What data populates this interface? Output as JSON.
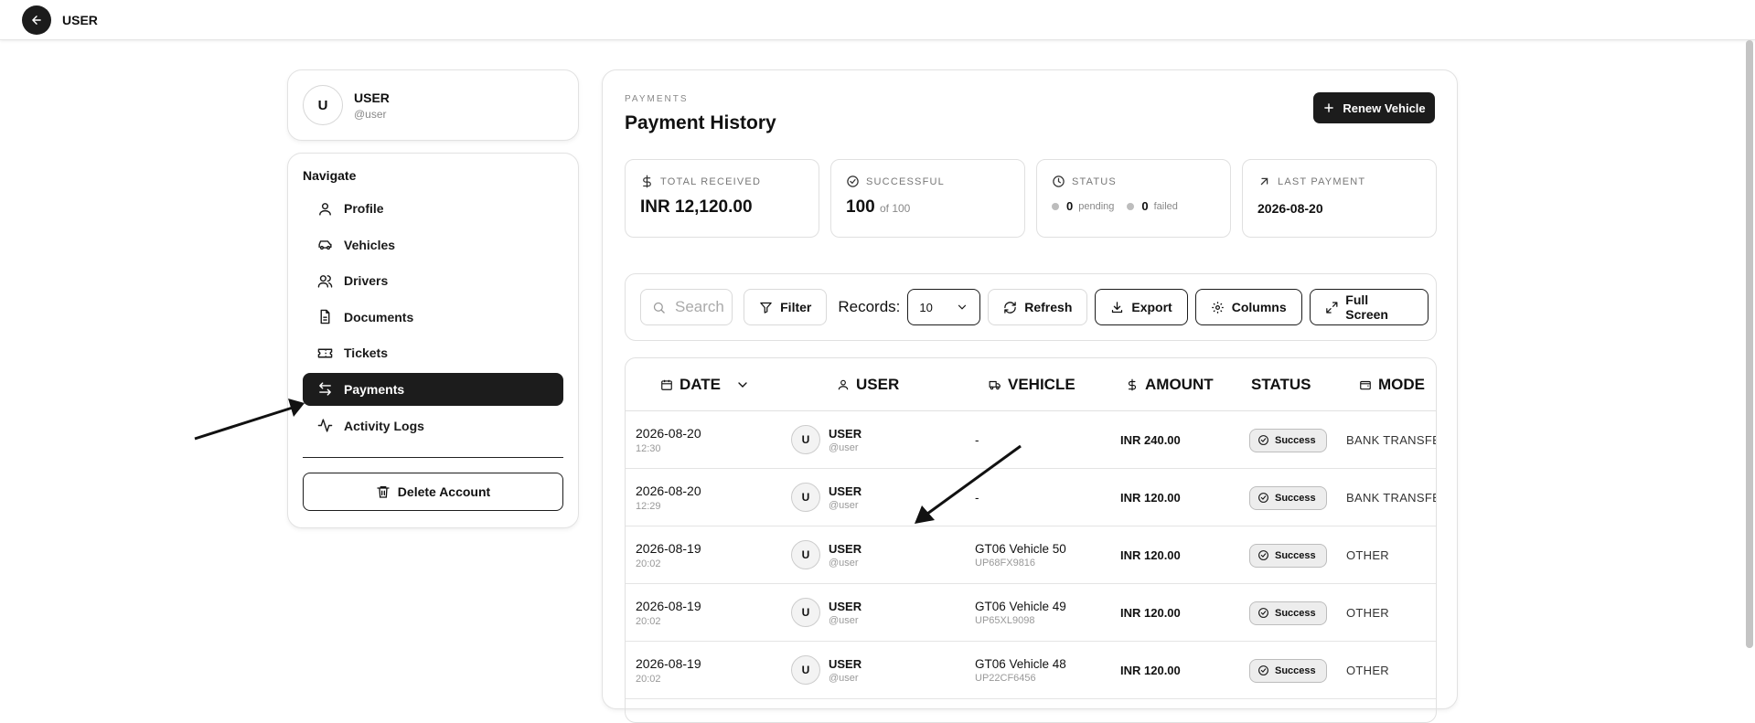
{
  "topbar": {
    "title": "USER"
  },
  "profile": {
    "initial": "U",
    "name": "USER",
    "handle": "@user"
  },
  "nav": {
    "heading": "Navigate",
    "items": [
      {
        "label": "Profile",
        "icon": "user-icon"
      },
      {
        "label": "Vehicles",
        "icon": "car-icon"
      },
      {
        "label": "Drivers",
        "icon": "users-icon"
      },
      {
        "label": "Documents",
        "icon": "file-text-icon"
      },
      {
        "label": "Tickets",
        "icon": "ticket-icon"
      },
      {
        "label": "Payments",
        "icon": "arrows-left-right-icon",
        "active": true
      },
      {
        "label": "Activity Logs",
        "icon": "activity-icon"
      }
    ],
    "delete_label": "Delete Account"
  },
  "main": {
    "eyebrow": "PAYMENTS",
    "title": "Payment History",
    "renew_label": "Renew Vehicle"
  },
  "stats": {
    "total_received": {
      "label": "TOTAL RECEIVED",
      "value": "INR 12,120.00"
    },
    "successful": {
      "label": "SUCCESSFUL",
      "value": "100",
      "of": "of 100"
    },
    "status": {
      "label": "STATUS",
      "pending_count": "0",
      "pending_label": "pending",
      "failed_count": "0",
      "failed_label": "failed"
    },
    "last_payment": {
      "label": "LAST PAYMENT",
      "value": "2026-08-20"
    }
  },
  "toolbar": {
    "search_placeholder": "Search",
    "filter_label": "Filter",
    "records_label": "Records:",
    "records_value": "10",
    "refresh_label": "Refresh",
    "export_label": "Export",
    "columns_label": "Columns",
    "fullscreen_label": "Full Screen"
  },
  "table": {
    "headers": {
      "date": "DATE",
      "user": "USER",
      "vehicle": "VEHICLE",
      "amount": "AMOUNT",
      "status": "STATUS",
      "mode": "MODE"
    },
    "rows": [
      {
        "date": "2026-08-20",
        "time": "12:30",
        "initial": "U",
        "user": "USER",
        "handle": "@user",
        "vehicle": "-",
        "plate": "",
        "amount": "INR 240.00",
        "status": "Success",
        "mode": "BANK TRANSFER"
      },
      {
        "date": "2026-08-20",
        "time": "12:29",
        "initial": "U",
        "user": "USER",
        "handle": "@user",
        "vehicle": "-",
        "plate": "",
        "amount": "INR 120.00",
        "status": "Success",
        "mode": "BANK TRANSFER"
      },
      {
        "date": "2026-08-19",
        "time": "20:02",
        "initial": "U",
        "user": "USER",
        "handle": "@user",
        "vehicle": "GT06 Vehicle 50",
        "plate": "UP68FX9816",
        "amount": "INR 120.00",
        "status": "Success",
        "mode": "OTHER"
      },
      {
        "date": "2026-08-19",
        "time": "20:02",
        "initial": "U",
        "user": "USER",
        "handle": "@user",
        "vehicle": "GT06 Vehicle 49",
        "plate": "UP65XL9098",
        "amount": "INR 120.00",
        "status": "Success",
        "mode": "OTHER"
      },
      {
        "date": "2026-08-19",
        "time": "20:02",
        "initial": "U",
        "user": "USER",
        "handle": "@user",
        "vehicle": "GT06 Vehicle 48",
        "plate": "UP22CF6456",
        "amount": "INR 120.00",
        "status": "Success",
        "mode": "OTHER"
      }
    ]
  },
  "colors": {
    "accent": "#1c1c1c",
    "badge_bg": "#ededed",
    "border": "#e0e0e0"
  }
}
